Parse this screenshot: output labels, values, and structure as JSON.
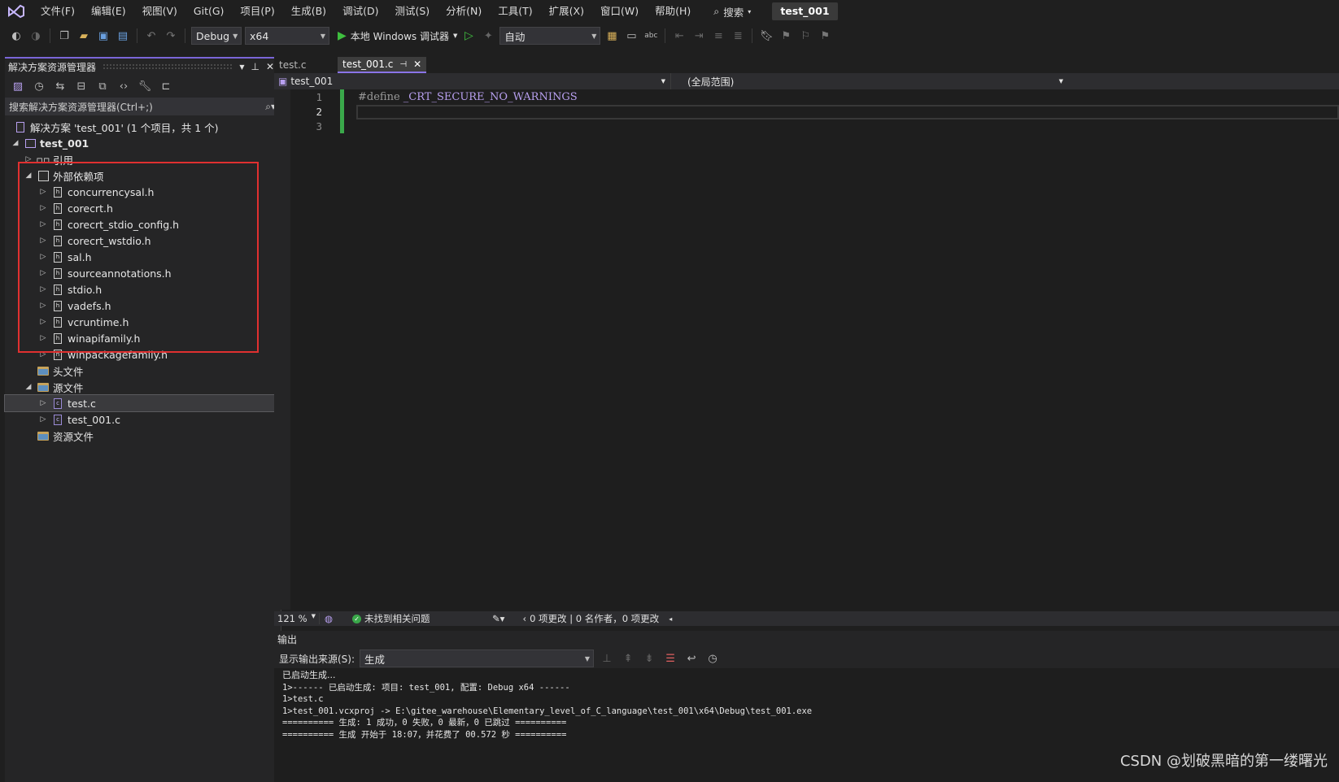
{
  "menubar": {
    "items": [
      "文件(F)",
      "编辑(E)",
      "视图(V)",
      "Git(G)",
      "项目(P)",
      "生成(B)",
      "调试(D)",
      "测试(S)",
      "分析(N)",
      "工具(T)",
      "扩展(X)",
      "窗口(W)",
      "帮助(H)"
    ],
    "search_label": "搜索",
    "project_title": "test_001"
  },
  "toolbar": {
    "config": "Debug",
    "platform": "x64",
    "debugger": "本地 Windows 调试器",
    "mode": "自动"
  },
  "solution_explorer": {
    "title": "解决方案资源管理器",
    "search_placeholder": "搜索解决方案资源管理器(Ctrl+;)",
    "solution_label": "解决方案 'test_001' (1 个项目，共 1 个)",
    "project": "test_001",
    "references": "引用",
    "external_deps": "外部依赖项",
    "headers": [
      "concurrencysal.h",
      "corecrt.h",
      "corecrt_stdio_config.h",
      "corecrt_wstdio.h",
      "sal.h",
      "sourceannotations.h",
      "stdio.h",
      "vadefs.h",
      "vcruntime.h",
      "winapifamily.h",
      "winpackagefamily.h"
    ],
    "header_files_folder": "头文件",
    "source_files_folder": "源文件",
    "source_files": [
      "test.c",
      "test_001.c"
    ],
    "resource_files_folder": "资源文件"
  },
  "editor": {
    "tabs": [
      "test.c",
      "test_001.c"
    ],
    "nav_file": "test_001",
    "nav_scope": "(全局范围)",
    "line_numbers": [
      "1",
      "2",
      "3"
    ],
    "code_keyword": "#define",
    "code_macro": "_CRT_SECURE_NO_WARNINGS"
  },
  "editor_status": {
    "zoom": "121 %",
    "issues": "未找到相关问题",
    "changes": "0 项更改 | 0 名作者，0 项更改"
  },
  "output": {
    "title": "输出",
    "source_label": "显示输出来源(S):",
    "source_value": "生成",
    "lines": [
      "已启动生成...",
      "1>------ 已启动生成: 项目: test_001, 配置: Debug x64 ------",
      "1>test.c",
      "1>test_001.vcxproj -> E:\\gitee_warehouse\\Elementary_level_of_C_language\\test_001\\x64\\Debug\\test_001.exe",
      "========== 生成: 1 成功，0 失败，0 最新，0 已跳过 ==========",
      "========== 生成 开始于 18:07，并花费了 00.572 秒 =========="
    ]
  },
  "watermark": "CSDN @划破黑暗的第一缕曙光"
}
